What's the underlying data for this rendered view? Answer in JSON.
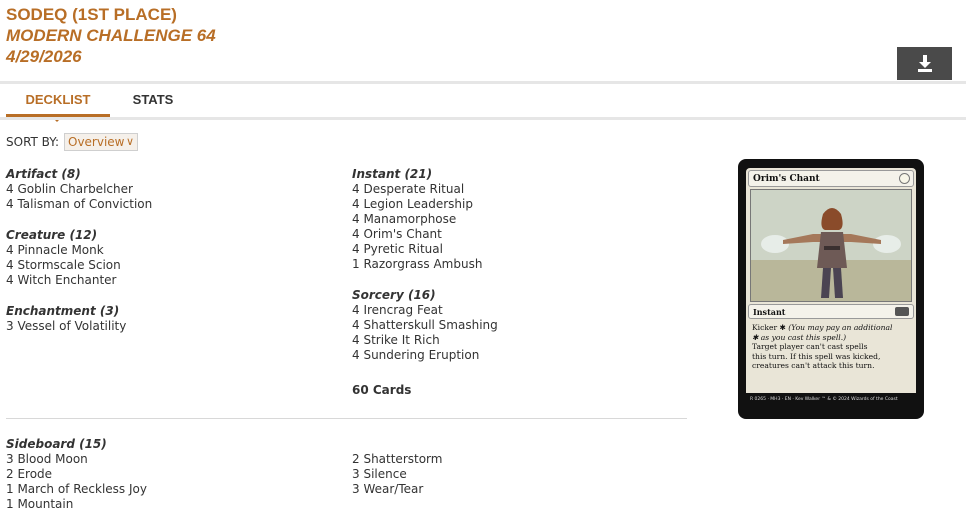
{
  "header": {
    "player_line": "SODEQ (1ST PLACE)",
    "event_line": "MODERN CHALLENGE 64",
    "date_line": "4/29/2026"
  },
  "toolbar": {
    "download_icon": "download-icon"
  },
  "tabs": [
    {
      "label": "DECKLIST",
      "active": true
    },
    {
      "label": "STATS",
      "active": false
    }
  ],
  "sort": {
    "label": "SORT BY:",
    "value": "Overview"
  },
  "colors": {
    "accent": "#b86e26",
    "button_dark": "#4a4a4a"
  },
  "deck": {
    "artifact": {
      "header": "Artifact (8)",
      "cards": [
        "4 Goblin Charbelcher",
        "4 Talisman of Conviction"
      ]
    },
    "creature": {
      "header": "Creature (12)",
      "cards": [
        "4 Pinnacle Monk",
        "4 Stormscale Scion",
        "4 Witch Enchanter"
      ]
    },
    "enchantment": {
      "header": "Enchantment (3)",
      "cards": [
        "3 Vessel of Volatility"
      ]
    },
    "instant": {
      "header": "Instant (21)",
      "cards": [
        "4 Desperate Ritual",
        "4 Legion Leadership",
        "4 Manamorphose",
        "4 Orim's Chant",
        "4 Pyretic Ritual",
        "1 Razorgrass Ambush"
      ]
    },
    "sorcery": {
      "header": "Sorcery (16)",
      "cards": [
        "4 Irencrag Feat",
        "4 Shatterskull Smashing",
        "4 Strike It Rich",
        "4 Sundering Eruption"
      ]
    },
    "total": "60 Cards"
  },
  "sideboard": {
    "header": "Sideboard (15)",
    "left": [
      "3 Blood Moon",
      "2 Erode",
      "1 March of Reckless Joy",
      "1 Mountain"
    ],
    "right": [
      "2 Shatterstorm",
      "3 Silence",
      "3 Wear/Tear"
    ]
  },
  "card_preview": {
    "name": "Orim's Chant",
    "type": "Instant",
    "kicker": "Kicker",
    "kicker_reminder": "(You may pay an additional",
    "kicker_reminder2": "as you cast this spell.)",
    "rules_1": "Target player can't cast spells",
    "rules_2": "this turn. If this spell was kicked,",
    "rules_3": "creatures can't attack this turn.",
    "footer": "R 0265 · MH3 · EN · Kev Walker   ™ & © 2024 Wizards of the Coast"
  }
}
